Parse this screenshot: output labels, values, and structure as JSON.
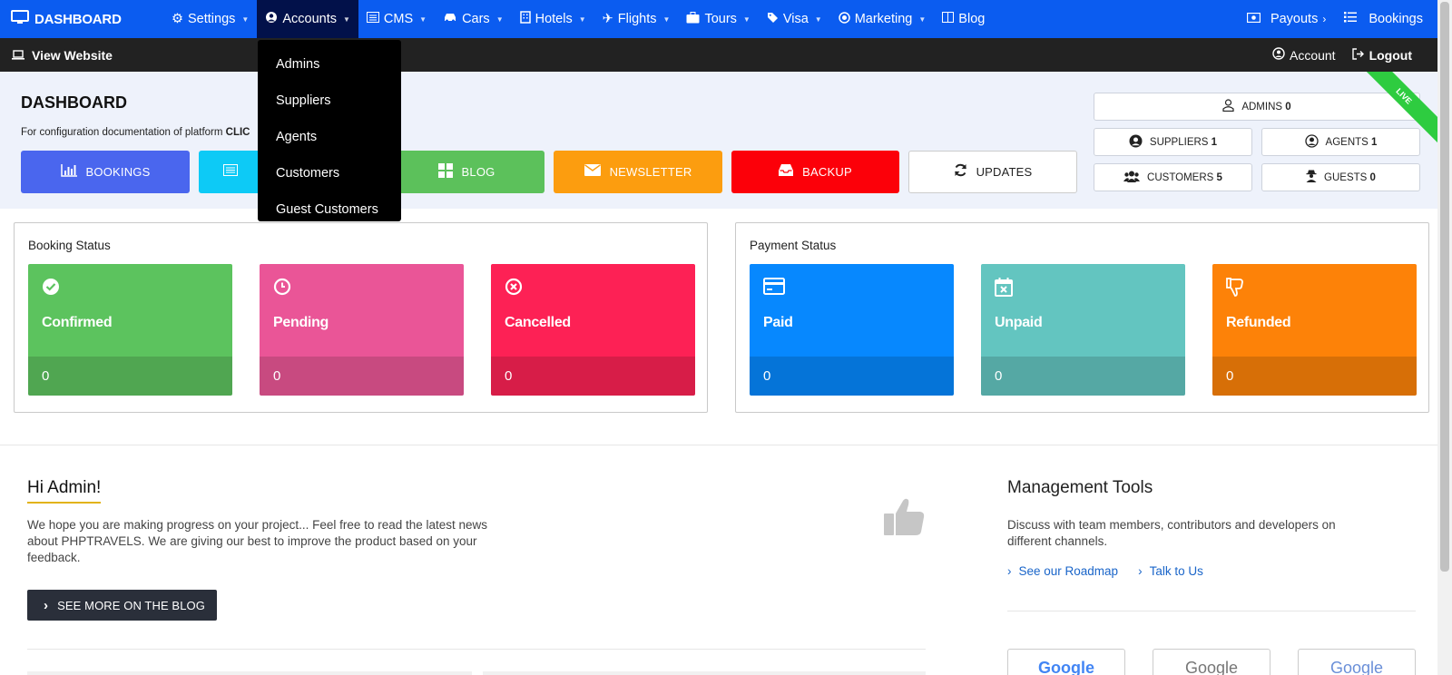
{
  "topnav": {
    "brand": "DASHBOARD",
    "items": [
      {
        "label": "Settings",
        "icon": "gear-icon",
        "caret": true
      },
      {
        "label": "Accounts",
        "icon": "user-circle-icon",
        "caret": true
      },
      {
        "label": "CMS",
        "icon": "list-icon",
        "caret": true
      },
      {
        "label": "Cars",
        "icon": "car-icon",
        "caret": true
      },
      {
        "label": "Hotels",
        "icon": "building-icon",
        "caret": true
      },
      {
        "label": "Flights",
        "icon": "plane-icon",
        "caret": true
      },
      {
        "label": "Tours",
        "icon": "briefcase-icon",
        "caret": true
      },
      {
        "label": "Visa",
        "icon": "tag-icon",
        "caret": true
      },
      {
        "label": "Marketing",
        "icon": "target-icon",
        "caret": true
      },
      {
        "label": "Blog",
        "icon": "book-icon",
        "caret": false
      }
    ],
    "right": {
      "payouts": "Payouts",
      "bookings": "Bookings"
    }
  },
  "subbar": {
    "view_website": "View Website",
    "account": "Account",
    "logout": "Logout"
  },
  "dropdown": {
    "items": [
      "Admins",
      "Suppliers",
      "Agents",
      "Customers",
      "Guest Customers"
    ]
  },
  "hero": {
    "title": "DASHBOARD",
    "doc_text": "For configuration documentation of platform ",
    "doc_bold": "CLIC",
    "live": "LIVE",
    "buttons": {
      "bookings": "BOOKINGS",
      "blog": "BLOG",
      "newsletter": "NEWSLETTER",
      "backup": "BACKUP",
      "updates": "UPDATES"
    },
    "stats": {
      "admins_label": "ADMINS",
      "admins_count": "0",
      "suppliers_label": "SUPPLIERS",
      "suppliers_count": "1",
      "agents_label": "AGENTS",
      "agents_count": "1",
      "customers_label": "CUSTOMERS",
      "customers_count": "5",
      "guests_label": "GUESTS",
      "guests_count": "0"
    }
  },
  "booking_status": {
    "title": "Booking Status",
    "cards": [
      {
        "label": "Confirmed",
        "value": "0",
        "color": "#5cc35e",
        "dark": "#50a651"
      },
      {
        "label": "Pending",
        "value": "0",
        "color": "#ea5597",
        "dark": "#c84a80"
      },
      {
        "label": "Cancelled",
        "value": "0",
        "color": "#fd2155",
        "dark": "#d71d48"
      }
    ]
  },
  "payment_status": {
    "title": "Payment Status",
    "cards": [
      {
        "label": "Paid",
        "value": "0",
        "color": "#0788fe",
        "dark": "#0574d8"
      },
      {
        "label": "Unpaid",
        "value": "0",
        "color": "#63c5c0",
        "dark": "#55a8a4"
      },
      {
        "label": "Refunded",
        "value": "0",
        "color": "#fd8208",
        "dark": "#d76f07"
      }
    ]
  },
  "welcome": {
    "title": "Hi Admin!",
    "text": "We hope you are making progress on your project... Feel free to read the latest news about PHPTRAVELS. We are giving our best to improve the product based on your feedback.",
    "button": "SEE MORE ON THE BLOG"
  },
  "management": {
    "title": "Management Tools",
    "text": "Discuss with team members, contributors and developers on different channels.",
    "links": [
      "See our Roadmap",
      "Talk to Us"
    ],
    "logos": [
      "Google",
      "Google",
      "Google"
    ]
  }
}
